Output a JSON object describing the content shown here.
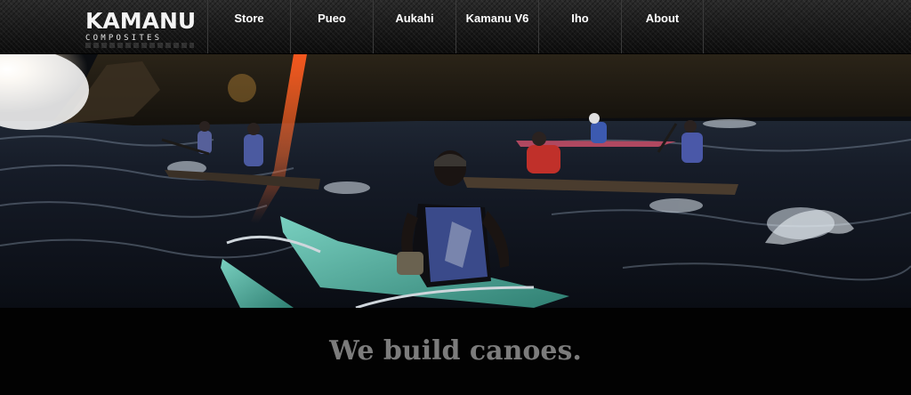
{
  "brand": {
    "name": "KAMANU",
    "subtitle": "COMPOSITES"
  },
  "nav": {
    "items": [
      {
        "label": "Store"
      },
      {
        "label": "Pueo"
      },
      {
        "label": "Aukahi"
      },
      {
        "label": "Kamanu V6"
      },
      {
        "label": "Iho"
      },
      {
        "label": "About"
      }
    ]
  },
  "hero": {
    "image_icon": "outrigger-canoe-paddlers-photo"
  },
  "tagline": "We build canoes.",
  "colors": {
    "header_bg": "#161616",
    "nav_text": "#ffffff",
    "tagline_text": "#7c7c7c",
    "page_bg": "#020202",
    "canoe_hull": "#5fb8a8"
  }
}
